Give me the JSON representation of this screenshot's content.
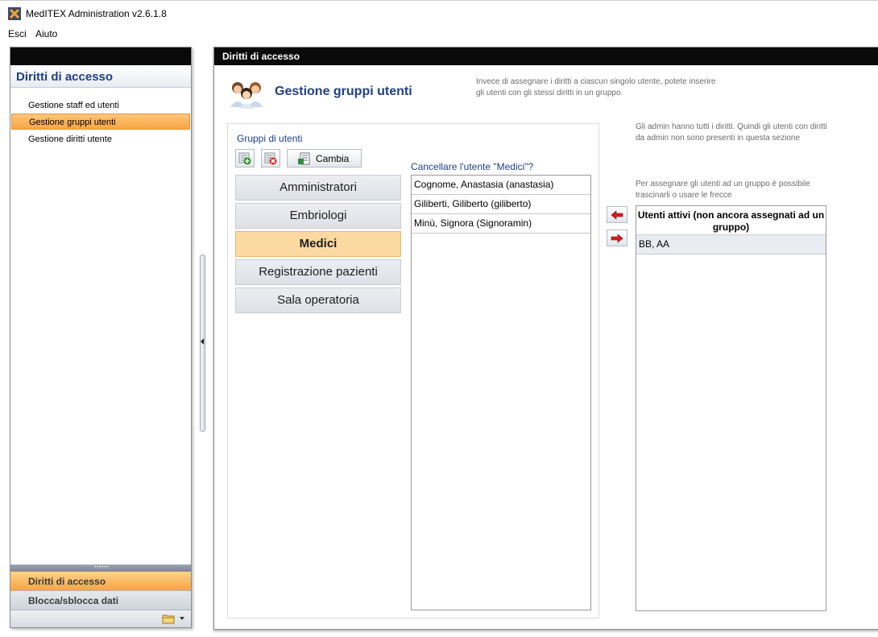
{
  "window": {
    "title": "MedITEX Administration v2.6.1.8"
  },
  "menu": {
    "items": [
      "Esci",
      "Aiuto"
    ]
  },
  "sidebar": {
    "header": "Diritti di accesso",
    "items": [
      {
        "label": "Gestione staff ed utenti",
        "active": false
      },
      {
        "label": "Gestione gruppi utenti",
        "active": true
      },
      {
        "label": "Gestione diritti utente",
        "active": false
      }
    ],
    "panes": [
      "Diritti di accesso",
      "Blocca/sblocca dati"
    ]
  },
  "main": {
    "panel_title": "Diritti di accesso",
    "page_title": "Gestione gruppi utenti",
    "info": "Invece di assegnare i diritti a ciascun singolo utente, potete inserire gli utenti con gli stessi diritti in un gruppo.",
    "groups_label": "Gruppi di utenti",
    "cambia_label": "Cambia",
    "groups": [
      {
        "label": "Amministratori",
        "selected": false
      },
      {
        "label": "Embriologi",
        "selected": false
      },
      {
        "label": "Medici",
        "selected": true
      },
      {
        "label": "Registrazione pazienti",
        "selected": false
      },
      {
        "label": "Sala operatoria",
        "selected": false
      }
    ],
    "delete_question": "Cancellare l'utente \"Medici\"?",
    "group_users": [
      "Cognome, Anastasia  (anastasia)",
      "Giliberti, Giliberto  (giliberto)",
      "Minù, Signora  (Signoramin)"
    ],
    "admin_note": "Gli admin hanno tutti i diritti. Quindi gli utenti con diritti da admin non sono presenti in questa sezione",
    "drag_note": "Per assegnare gli utenti ad un gruppo è possibile trascinarli o usare le frecce",
    "active_users_header": "Utenti attivi (non ancora assegnati ad un gruppo)",
    "active_users": [
      "BB, AA"
    ]
  },
  "colors": {
    "accent_orange": "#f7a543",
    "title_blue": "#1f3f86",
    "selected_group": "#fbd9a0"
  }
}
